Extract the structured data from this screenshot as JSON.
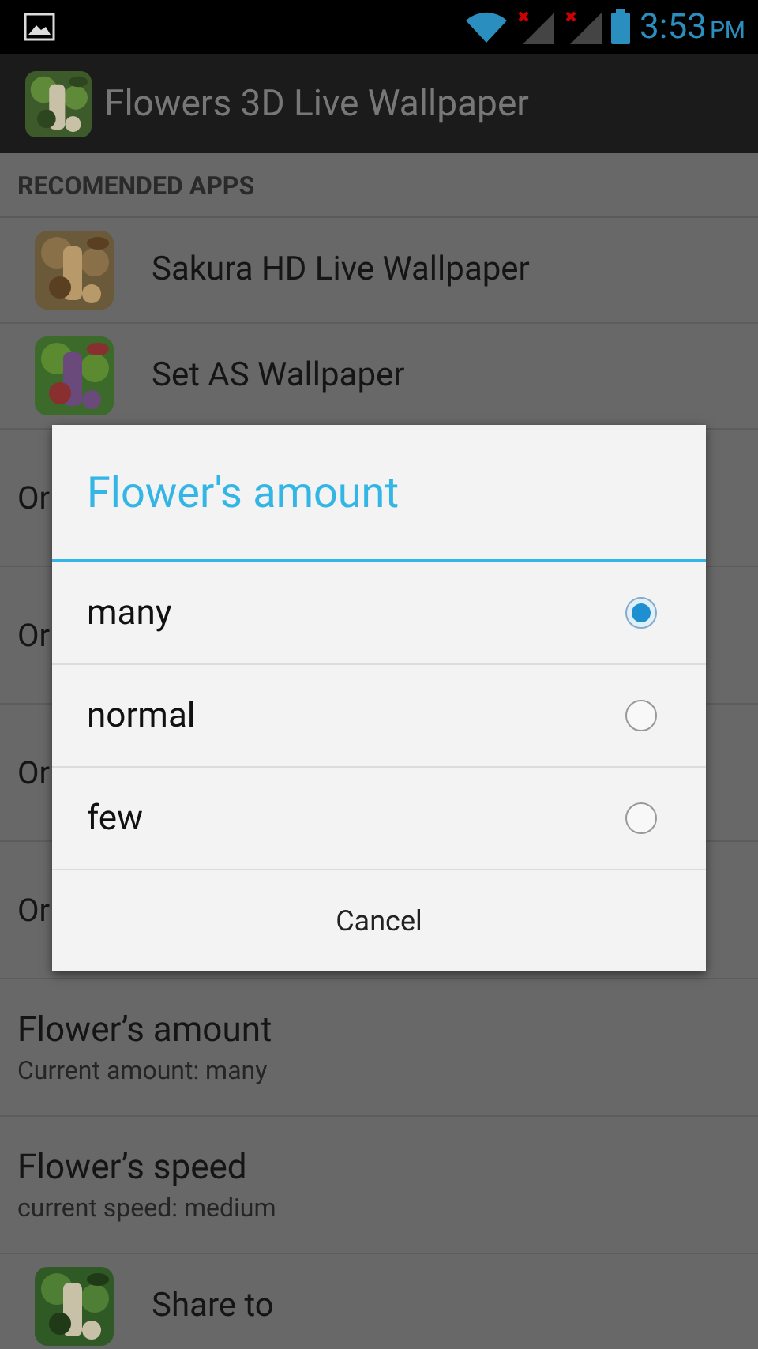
{
  "status_bar": {
    "time": "3:53",
    "ampm": "PM"
  },
  "action_bar": {
    "title": "Flowers 3D Live Wallpaper"
  },
  "section_header": "RECOMENDED APPS",
  "recommended_apps": [
    {
      "name": "Sakura HD Live Wallpaper"
    },
    {
      "name": "Set AS Wallpaper"
    }
  ],
  "settings": [
    {
      "kind": "covered",
      "title": "Or"
    },
    {
      "kind": "covered",
      "title": "Or"
    },
    {
      "kind": "covered",
      "title": "Or"
    },
    {
      "kind": "covered",
      "title": "Or"
    },
    {
      "kind": "setting",
      "title": "Flower’s amount",
      "summary": "Current amount: many"
    },
    {
      "kind": "setting",
      "title": "Flower’s speed",
      "summary": "current speed: medium"
    },
    {
      "kind": "app",
      "title": "Share to"
    }
  ],
  "dialog": {
    "title": "Flower's amount",
    "options": [
      {
        "label": "many",
        "selected": true
      },
      {
        "label": "normal",
        "selected": false
      },
      {
        "label": "few",
        "selected": false
      }
    ],
    "cancel": "Cancel"
  }
}
